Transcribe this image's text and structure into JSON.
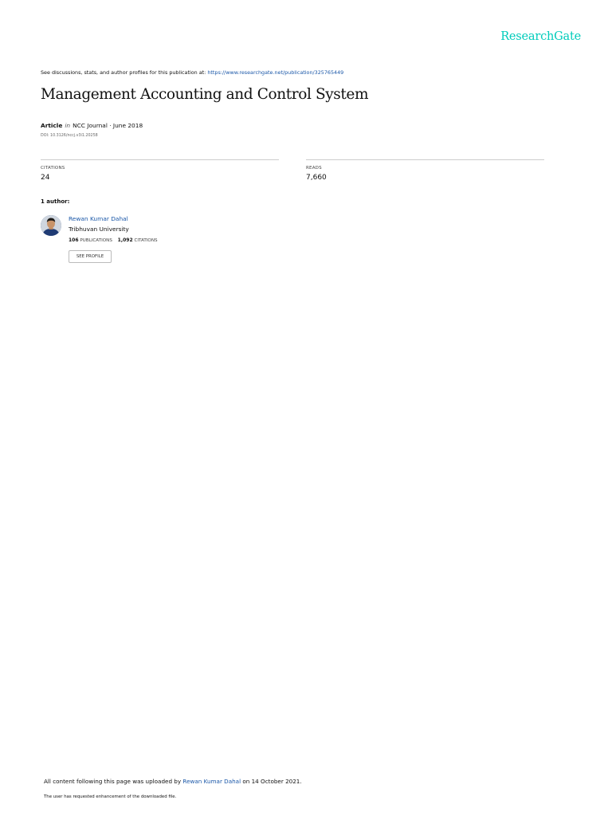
{
  "header": {
    "brand": "ResearchGate",
    "discussion_prefix": "See discussions, stats, and author profiles for this publication at: ",
    "discussion_link": "https://www.researchgate.net/publication/325765449"
  },
  "publication": {
    "title": "Management Accounting and Control System",
    "type": "Article",
    "in_word": "in",
    "venue_date": "NCC Journal · June 2018",
    "doi": "DOI: 10.3126/nccj.v3i1.20258"
  },
  "stats": {
    "citations_label": "CITATIONS",
    "citations_value": "24",
    "reads_label": "READS",
    "reads_value": "7,660"
  },
  "authors": {
    "heading": "1 author:",
    "list": [
      {
        "name": "Rewan Kumar Dahal",
        "affiliation": "Tribhuvan University",
        "publications_count": "106",
        "publications_label": "PUBLICATIONS",
        "citations_count": "1,092",
        "citations_label": "CITATIONS",
        "button_label": "SEE PROFILE"
      }
    ]
  },
  "footer": {
    "upload_prefix": "All content following this page was uploaded by ",
    "uploader": "Rewan Kumar Dahal",
    "upload_suffix": " on 14 October 2021.",
    "note": "The user has requested enhancement of the downloaded file."
  },
  "colors": {
    "brand": "#00ccbb",
    "link": "#1a57a8",
    "divider": "#cccccc"
  }
}
